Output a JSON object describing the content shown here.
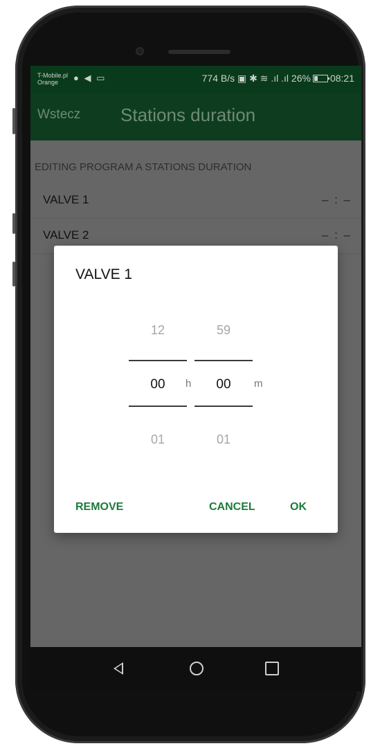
{
  "status_bar": {
    "carrier_line1": "T-Mobile.pl",
    "carrier_line2": "Orange",
    "left_icons": "● ◀ ▭",
    "network_speed": "774 B/s",
    "right_icons": "▣ ✱ ≋ .ıl .ıl",
    "battery_percent": "26%",
    "time": "08:21"
  },
  "app_bar": {
    "back_label": "Wstecz",
    "title": "Stations duration"
  },
  "list": {
    "header": "EDITING PROGRAM A STATIONS DURATION",
    "rows": [
      {
        "label": "VALVE 1",
        "value": "– : –"
      },
      {
        "label": "VALVE 2",
        "value": "– : –"
      }
    ]
  },
  "dialog": {
    "title": "VALVE 1",
    "hours": {
      "prev": "12",
      "selected": "00",
      "next": "01",
      "unit": "h"
    },
    "minutes": {
      "prev": "59",
      "selected": "00",
      "next": "01",
      "unit": "m"
    },
    "buttons": {
      "remove": "REMOVE",
      "cancel": "CANCEL",
      "ok": "OK"
    }
  },
  "nav_bar": {
    "back_icon": "triangle-back-icon",
    "home_icon": "circle-home-icon",
    "recents_icon": "square-recents-icon"
  },
  "colors": {
    "app_bar": "#0d3d1e",
    "accent_button": "#1c7a3c",
    "scrim": "#666666"
  }
}
